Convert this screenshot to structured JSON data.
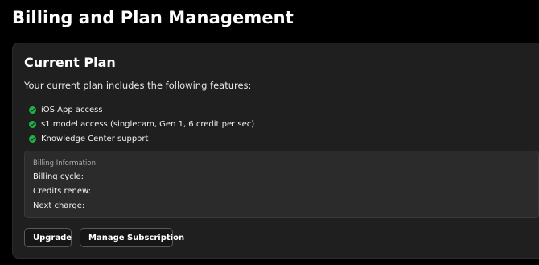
{
  "page": {
    "title": "Billing and Plan Management"
  },
  "current_plan": {
    "title": "Current Plan",
    "description": "Your current plan includes the following features:",
    "features": [
      {
        "label": "iOS App access",
        "icon": "check-circle-icon"
      },
      {
        "label": "s1 model access (singlecam, Gen 1, 6 credit per sec)",
        "icon": "check-circle-icon"
      },
      {
        "label": "Knowledge Center support",
        "icon": "check-circle-icon"
      }
    ]
  },
  "billing": {
    "heading": "Billing Information",
    "billing_cycle_label": "Billing cycle:",
    "credits_renew_label": "Credits renew:",
    "next_charge_label": "Next charge:"
  },
  "actions": {
    "upgrade_label": "Upgrade",
    "manage_label": "Manage Subscription"
  },
  "colors": {
    "background": "#000000",
    "card": "#1f1f1f",
    "billing_box": "#2b2b2b",
    "check": "#22b04b",
    "button_border": "#595959"
  }
}
